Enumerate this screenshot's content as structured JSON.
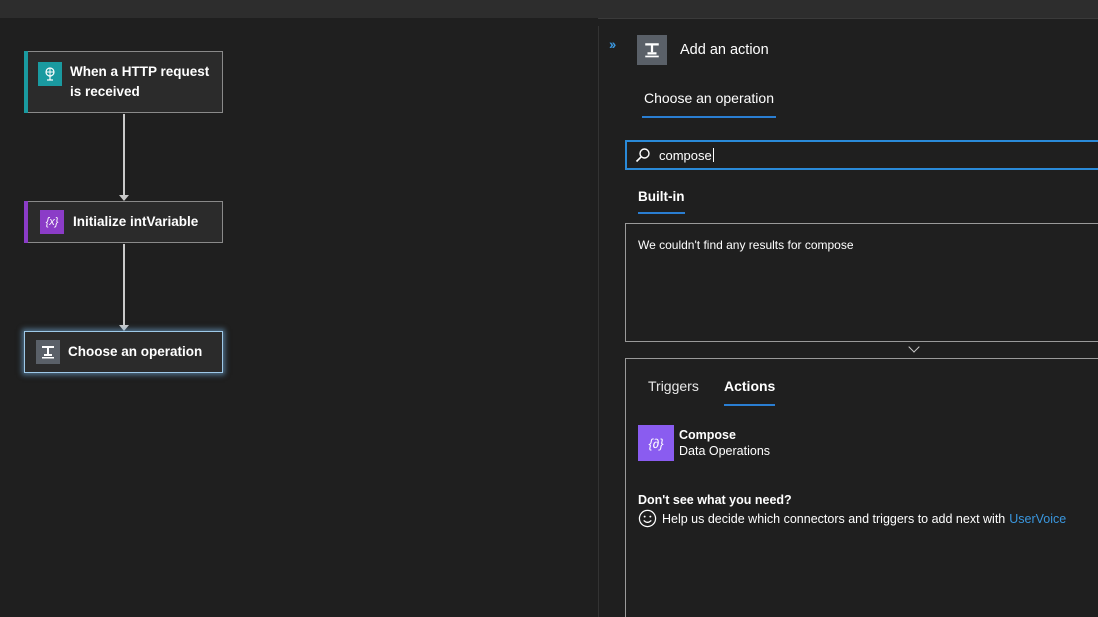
{
  "canvas": {
    "steps": [
      {
        "title": "When a HTTP request is received",
        "icon": "http-request-icon",
        "color": "#1a9aa0"
      },
      {
        "title": "Initialize intVariable",
        "icon": "variable-icon",
        "color": "#8b3cc7"
      },
      {
        "title": "Choose an operation",
        "icon": "operation-icon",
        "color": "#5a6068"
      }
    ]
  },
  "panel": {
    "collapse_glyph": "››",
    "title": "Add an action",
    "tab": "Choose an operation",
    "search": {
      "value": "compose"
    },
    "category_tab": "Built-in",
    "no_results": "We couldn't find any results for compose",
    "tabs": {
      "triggers": "Triggers",
      "actions": "Actions"
    },
    "results": [
      {
        "name": "Compose",
        "connector": "Data Operations",
        "icon": "compose-icon",
        "color": "#8a5cf0"
      }
    ],
    "help": {
      "heading": "Don't see what you need?",
      "text": "Help us decide which connectors and triggers to add next with",
      "link": "UserVoice"
    }
  },
  "colors": {
    "accent": "#2a7ed2",
    "link": "#3a96dd",
    "background": "#1f1f1f"
  }
}
